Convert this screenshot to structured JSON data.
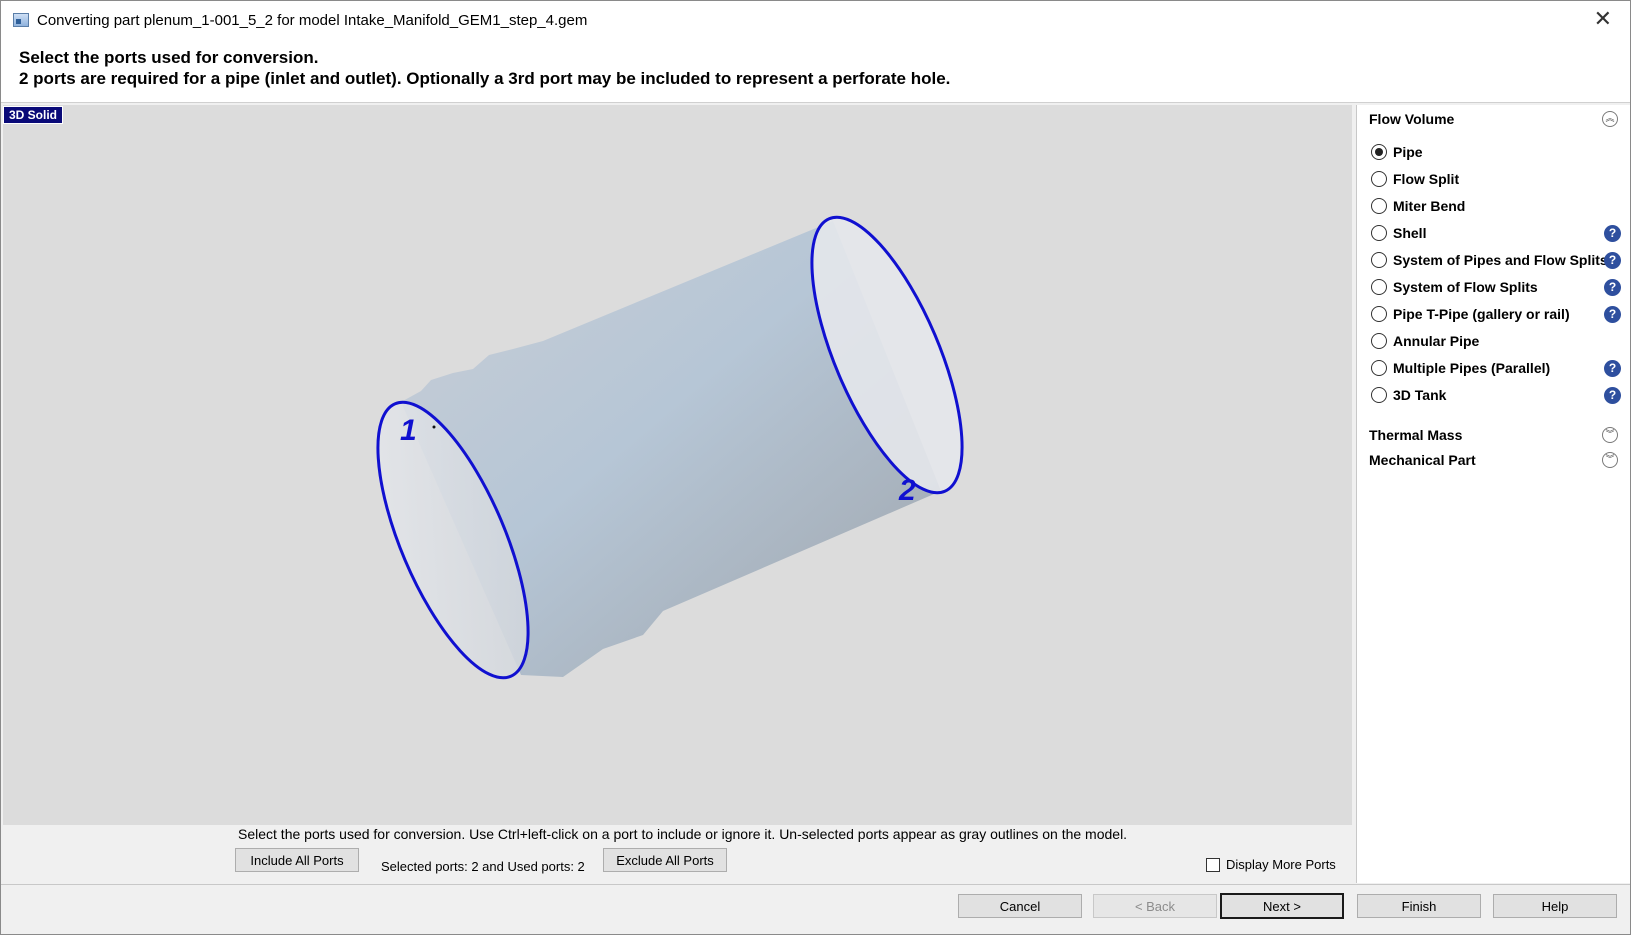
{
  "window": {
    "title": "Converting part plenum_1-001_5_2 for model Intake_Manifold_GEM1_step_4.gem",
    "close_glyph": "✕"
  },
  "instructions": {
    "line1": "Select the ports used for conversion.",
    "line2": "2 ports are required for a pipe (inlet and outlet). Optionally a 3rd port may be included to represent a perforate hole."
  },
  "viewport": {
    "tag": "3D Solid",
    "port1_label": "1",
    "port2_label": "2",
    "port_color": "#1010d0"
  },
  "ports_bar": {
    "hint": "Select the ports used for conversion. Use Ctrl+left-click on a port to include or ignore it. Un-selected ports appear as gray outlines on the model.",
    "include_all": "Include All Ports",
    "status": "Selected ports: 2 and Used ports: 2",
    "exclude_all": "Exclude All Ports",
    "display_more": "Display More Ports"
  },
  "side_panel": {
    "flow_volume": {
      "title": "Flow Volume",
      "options": [
        {
          "label": "Pipe",
          "selected": true,
          "help": false
        },
        {
          "label": "Flow Split",
          "selected": false,
          "help": false
        },
        {
          "label": "Miter Bend",
          "selected": false,
          "help": false
        },
        {
          "label": "Shell",
          "selected": false,
          "help": true
        },
        {
          "label": "System of Pipes and Flow Splits",
          "selected": false,
          "help": true
        },
        {
          "label": "System of Flow Splits",
          "selected": false,
          "help": true
        },
        {
          "label": "Pipe T-Pipe (gallery or rail)",
          "selected": false,
          "help": true
        },
        {
          "label": "Annular Pipe",
          "selected": false,
          "help": false
        },
        {
          "label": "Multiple Pipes (Parallel)",
          "selected": false,
          "help": true
        },
        {
          "label": "3D Tank",
          "selected": false,
          "help": true
        }
      ]
    },
    "thermal_mass": "Thermal Mass",
    "mechanical_part": "Mechanical Part",
    "help_glyph": "?",
    "collapse_glyph": "︽",
    "expand_glyph": "︾"
  },
  "buttons": {
    "cancel": "Cancel",
    "back": "< Back",
    "next": "Next >",
    "finish": "Finish",
    "help": "Help"
  }
}
